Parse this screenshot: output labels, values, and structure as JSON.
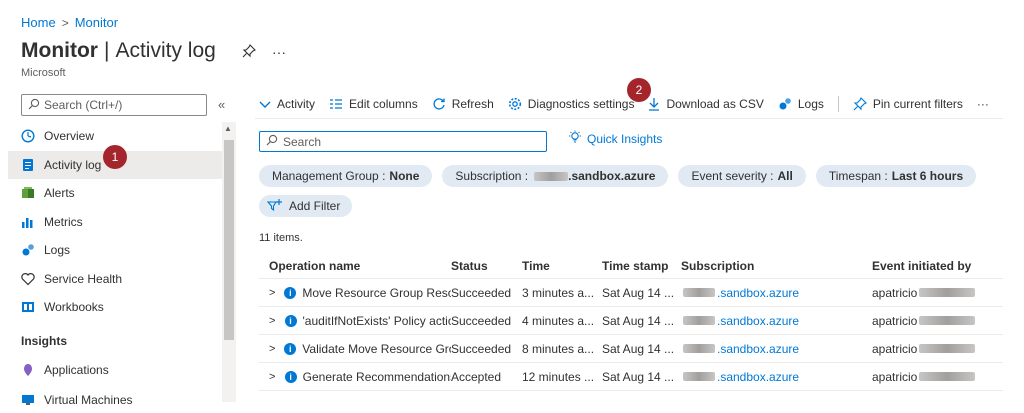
{
  "breadcrumb": {
    "home": "Home",
    "separator": ">",
    "current": "Monitor"
  },
  "title": {
    "main": "Monitor",
    "divider": "|",
    "section": "Activity log",
    "pin_icon": "pin-icon",
    "more": "···"
  },
  "subtitle": "Microsoft",
  "sidebar": {
    "search_placeholder": "Search (Ctrl+/)",
    "collapse": "«",
    "items": [
      {
        "label": "Overview",
        "icon": "overview-icon"
      },
      {
        "label": "Activity log",
        "icon": "activity-log-icon",
        "active": true
      },
      {
        "label": "Alerts",
        "icon": "alerts-icon"
      },
      {
        "label": "Metrics",
        "icon": "metrics-icon"
      },
      {
        "label": "Logs",
        "icon": "logs-icon"
      },
      {
        "label": "Service Health",
        "icon": "service-health-icon"
      },
      {
        "label": "Workbooks",
        "icon": "workbooks-icon"
      }
    ],
    "section_title": "Insights",
    "insights_items": [
      {
        "label": "Applications",
        "icon": "applications-icon"
      },
      {
        "label": "Virtual Machines",
        "icon": "virtual-machines-icon"
      }
    ]
  },
  "badges": {
    "one": "1",
    "two": "2"
  },
  "toolbar": {
    "activity": "Activity",
    "edit_columns": "Edit columns",
    "refresh": "Refresh",
    "diagnostics": "Diagnostics settings",
    "download": "Download as CSV",
    "logs": "Logs",
    "pin_filters": "Pin current filters",
    "more": "···"
  },
  "search": {
    "placeholder": "Search"
  },
  "quick_insights": "Quick Insights",
  "filters": {
    "management_group_label": "Management Group :",
    "management_group_value": "None",
    "subscription_label": "Subscription :",
    "subscription_value": ".sandbox.azure",
    "severity_label": "Event severity :",
    "severity_value": "All",
    "timespan_label": "Timespan :",
    "timespan_value": "Last 6 hours",
    "add_filter": "Add Filter"
  },
  "items_count": "11 items.",
  "table": {
    "headers": {
      "operation": "Operation name",
      "status": "Status",
      "time": "Time",
      "timestamp": "Time stamp",
      "subscription": "Subscription",
      "initiated_by": "Event initiated by"
    },
    "rows": [
      {
        "operation": "Move Resource Group Resou",
        "status": "Succeeded",
        "time": "3 minutes a...",
        "timestamp": "Sat Aug 14 ...",
        "subscription": ".sandbox.azure",
        "initiated_by": "apatricio"
      },
      {
        "operation": "'auditIfNotExists' Policy actior",
        "status": "Succeeded",
        "time": "4 minutes a...",
        "timestamp": "Sat Aug 14 ...",
        "subscription": ".sandbox.azure",
        "initiated_by": "apatricio"
      },
      {
        "operation": "Validate Move Resource Grou",
        "status": "Succeeded",
        "time": "8 minutes a...",
        "timestamp": "Sat Aug 14 ...",
        "subscription": ".sandbox.azure",
        "initiated_by": "apatricio"
      },
      {
        "operation": "Generate Recommendations",
        "status": "Accepted",
        "time": "12 minutes ...",
        "timestamp": "Sat Aug 14 ...",
        "subscription": ".sandbox.azure",
        "initiated_by": "apatricio"
      }
    ]
  }
}
